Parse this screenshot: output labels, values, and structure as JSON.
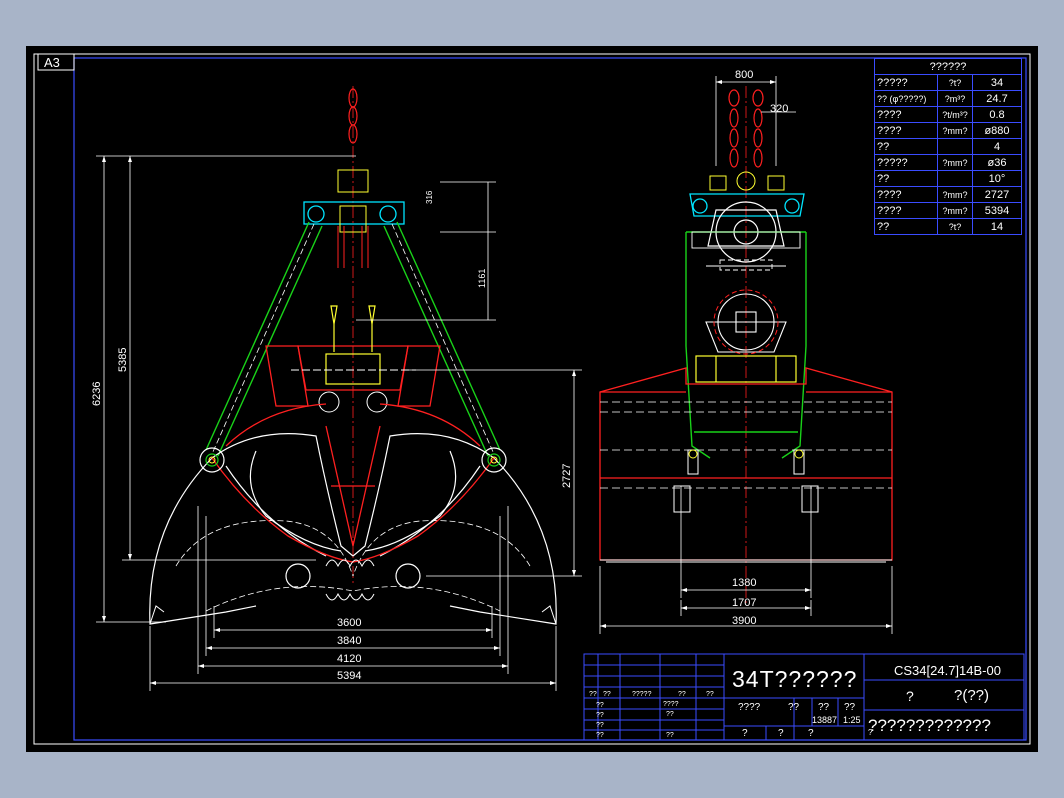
{
  "sheet": {
    "size_label": "A3"
  },
  "colors": {
    "sheet_bg": "#000000",
    "frame": "#3a4cff",
    "line_white": "#ffffff",
    "line_red": "#ff2020",
    "line_green": "#19d219",
    "line_cyan": "#00e5ff",
    "line_yellow": "#ffff30"
  },
  "front_view": {
    "dims": {
      "d316": "316",
      "d1161": "1161",
      "d5385": "5385",
      "d6236": "6236",
      "d2727": "2727",
      "d3600": "3600",
      "d3840": "3840",
      "d4120": "4120",
      "d5394": "5394"
    }
  },
  "side_view": {
    "dims": {
      "d800": "800",
      "d320": "320",
      "d1380": "1380",
      "d1707": "1707",
      "d3900": "3900"
    }
  },
  "param_table": {
    "title": "??????",
    "rows": [
      {
        "name": "?????",
        "unit": "?t?",
        "value": "34"
      },
      {
        "name": "?? (φ?????)",
        "unit": "?m³?",
        "value": "24.7"
      },
      {
        "name": "????",
        "unit": "?t/m³?",
        "value": "0.8"
      },
      {
        "name": "????",
        "unit": "?mm?",
        "value": "ø880"
      },
      {
        "name": "??",
        "unit": "",
        "value": "4"
      },
      {
        "name": "?????",
        "unit": "?mm?",
        "value": "ø36"
      },
      {
        "name": "??",
        "unit": "",
        "value": "10°"
      },
      {
        "name": "????",
        "unit": "?mm?",
        "value": "2727"
      },
      {
        "name": "????",
        "unit": "?mm?",
        "value": "5394"
      },
      {
        "name": "??",
        "unit": "?t?",
        "value": "14"
      }
    ]
  },
  "title_block": {
    "title": "34T??????",
    "drawing_code": "CS34[24.7]14B-00",
    "material_left": "?",
    "material_right": "?(??)",
    "company": "?????????????",
    "small_labels": {
      "a": "??",
      "b": "??",
      "c": "?????",
      "d": "??",
      "e": "??",
      "f": "??",
      "g": "????",
      "h": "??",
      "i": "??",
      "j": "??",
      "k": "??",
      "l": "????",
      "m": "??",
      "n": "??",
      "o": "??",
      "weight": "13887",
      "scale": "1:25",
      "p": "?",
      "q": "?",
      "r": "?",
      "s": "?"
    }
  }
}
